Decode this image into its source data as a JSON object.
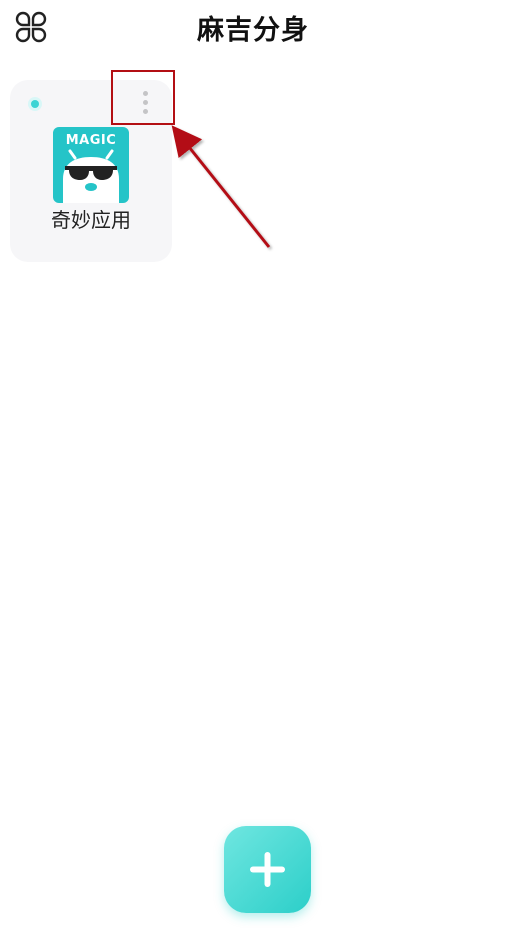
{
  "header": {
    "title": "麻吉分身",
    "menu_icon": "grid-menu-icon"
  },
  "apps": [
    {
      "name": "奇妙应用",
      "icon_text": "MAGIC",
      "icon_color": "#25c4c8",
      "status": "active",
      "status_color": "#3ad4d4"
    }
  ],
  "fab": {
    "icon": "plus-icon",
    "color": "#3ad4d4"
  },
  "annotation": {
    "color": "#b30f14"
  }
}
